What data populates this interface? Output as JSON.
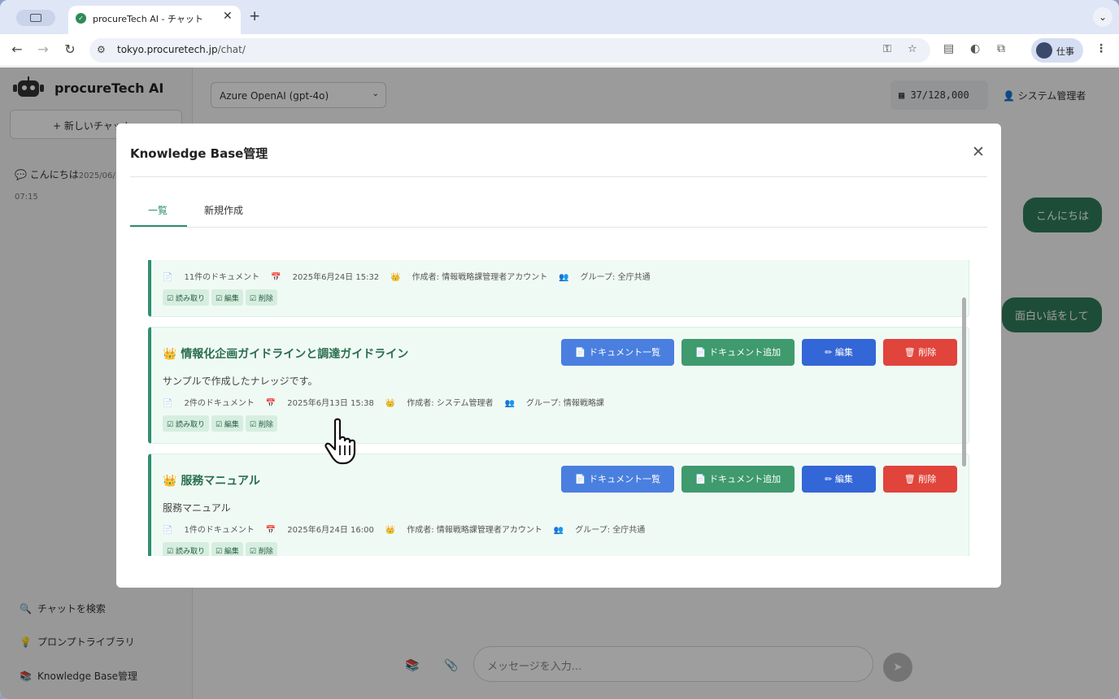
{
  "browser": {
    "tab_title": "procureTech AI - チャット",
    "url_host": "tokyo.procuretech.jp",
    "url_path": "/chat/",
    "profile_name": "仕事"
  },
  "sidebar": {
    "brand": "procureTech AI",
    "new_chat": "+ 新しいチャット",
    "history": [
      {
        "title": "こんにちは",
        "date": "2025/06/...",
        "time": "07:15"
      }
    ],
    "bottom": [
      {
        "icon": "search-icon",
        "label": "チャットを検索"
      },
      {
        "icon": "bulb-icon",
        "label": "プロンプトライブラリ"
      },
      {
        "icon": "books-icon",
        "label": "Knowledge Base管理"
      }
    ]
  },
  "topbar": {
    "model": "Azure OpenAI (gpt-4o)",
    "tokens": "37/128,000",
    "user": "システム管理者"
  },
  "chat": {
    "messages": [
      "こんにちは",
      "面白い話をして"
    ],
    "input_placeholder": "メッセージを入力..."
  },
  "modal": {
    "title": "Knowledge Base管理",
    "tabs": [
      "一覧",
      "新規作成"
    ],
    "button_labels": {
      "list": "ドキュメント一覧",
      "add": "ドキュメント追加",
      "edit": "編集",
      "delete": "削除"
    },
    "permissions": [
      "読み取り",
      "編集",
      "削除"
    ],
    "cards": [
      {
        "title": "",
        "description": "",
        "doc_count": "11件のドキュメント",
        "date": "2025年6月24日 15:32",
        "creator": "作成者: 情報戦略課管理者アカウント",
        "group": "グループ: 全庁共通"
      },
      {
        "title": "情報化企画ガイドラインと調達ガイドライン",
        "description": "サンプルで作成したナレッジです。",
        "doc_count": "2件のドキュメント",
        "date": "2025年6月13日 15:38",
        "creator": "作成者: システム管理者",
        "group": "グループ: 情報戦略課"
      },
      {
        "title": "服務マニュアル",
        "description": "服務マニュアル",
        "doc_count": "1件のドキュメント",
        "date": "2025年6月24日 16:00",
        "creator": "作成者: 情報戦略課管理者アカウント",
        "group": "グループ: 全庁共通"
      }
    ]
  }
}
